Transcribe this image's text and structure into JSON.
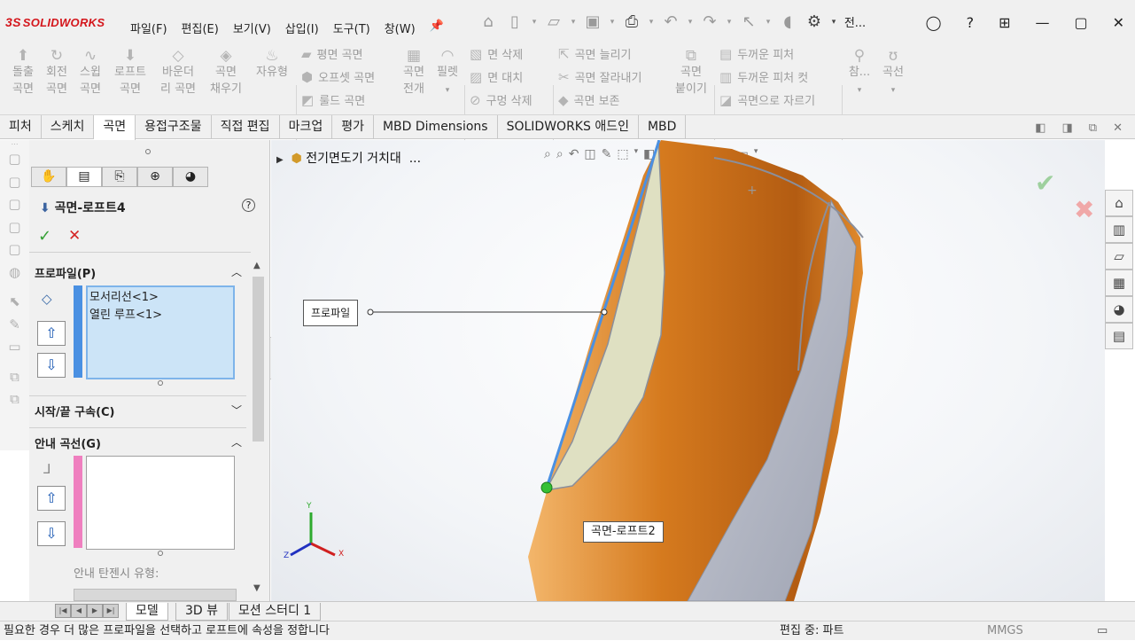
{
  "app": {
    "logo_ds": "3S",
    "logo_text": "SOLIDWORKS",
    "title_short": "전..."
  },
  "menu": [
    "파일(F)",
    "편집(E)",
    "보기(V)",
    "삽입(I)",
    "도구(T)",
    "창(W)"
  ],
  "ribbon": {
    "big": [
      {
        "icon": "extrude-surface-icon",
        "l1": "돌출",
        "l2": "곡면"
      },
      {
        "icon": "revolve-surface-icon",
        "l1": "회전",
        "l2": "곡면"
      },
      {
        "icon": "sweep-surface-icon",
        "l1": "스윕",
        "l2": "곡면"
      },
      {
        "icon": "loft-surface-icon",
        "l1": "로프트",
        "l2": "곡면"
      },
      {
        "icon": "boundary-surface-icon",
        "l1": "바운더",
        "l2": "리 곡면"
      },
      {
        "icon": "fill-surface-icon",
        "l1": "곡면",
        "l2": "채우기"
      },
      {
        "icon": "freeform-icon",
        "l1": "자유형",
        "l2": ""
      }
    ],
    "col1": [
      "평면 곡면",
      "오프셋 곡면",
      "룰드 곡면"
    ],
    "flatten": {
      "l1": "곡면",
      "l2": "전개"
    },
    "fillet": {
      "l1": "필렛",
      "l2": ""
    },
    "col2": [
      "면 삭제",
      "면 대치",
      "구멍 삭제"
    ],
    "col3": [
      "곡면 늘리기",
      "곡면 잘라내기",
      "곡면 보존"
    ],
    "knit": {
      "l1": "곡면",
      "l2": "붙이기"
    },
    "col4": [
      "두꺼운 피처",
      "두꺼운 피처 컷",
      "곡면으로 자르기"
    ],
    "ref": {
      "l1": "참...",
      "l2": ""
    },
    "curves": {
      "l1": "곡선",
      "l2": ""
    }
  },
  "tabs": [
    "피처",
    "스케치",
    "곡면",
    "용접구조물",
    "직접 편집",
    "마크업",
    "평가",
    "MBD Dimensions",
    "SOLIDWORKS 애드인",
    "MBD"
  ],
  "active_tab": "곡면",
  "panel": {
    "title": "곡면-로프트4",
    "help": "?",
    "ok": "✓",
    "cancel": "✕",
    "profiles": {
      "heading": "프로파일(P)",
      "items": [
        "모서리선<1>",
        "열린 루프<1>"
      ]
    },
    "start_end": {
      "heading": "시작/끝 구속(C)"
    },
    "guides": {
      "heading": "안내 곡선(G)",
      "tangency_label": "안내 탄젠시 유형:"
    }
  },
  "viewport": {
    "tree_item": "전기면도기 거치대",
    "tree_more": "...",
    "callout_profile": "프로파일",
    "callout_loft2": "곡면-로프트2",
    "triad": {
      "x": "X",
      "y": "Y",
      "z": "Z"
    }
  },
  "bottom_tabs": [
    "모델",
    "3D 뷰",
    "모션 스터디 1"
  ],
  "status": {
    "message": "필요한 경우 더 많은 프로파일을 선택하고 로프트에 속성을 정합니다",
    "mode": "편집 중: 파트",
    "units": "MMGS"
  },
  "colors": {
    "surface": "#d2791f",
    "profile": "#4a90e2",
    "guide_bar": "#ef7fbf"
  }
}
